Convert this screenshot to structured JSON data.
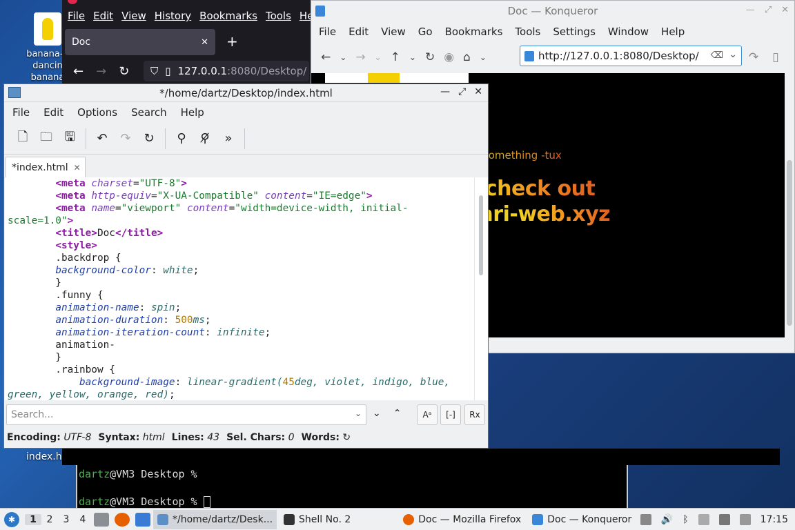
{
  "desktop": {
    "icons": [
      {
        "label": "banana-dancing-banana"
      },
      {
        "label": "index.html"
      }
    ],
    "icon_label_lines": [
      "banana-d",
      "dancin",
      "banana"
    ],
    "index_label": "index.h"
  },
  "firefox": {
    "menu": [
      "File",
      "Edit",
      "View",
      "History",
      "Bookmarks",
      "Tools",
      "Help"
    ],
    "tab_title": "Doc",
    "url_host": "127.0.0.1",
    "url_rest": ":8080/Desktop/"
  },
  "konqueror": {
    "title": "Doc — Konqueror",
    "menu": [
      "File",
      "Edit",
      "View",
      "Go",
      "Bookmarks",
      "Tools",
      "Settings",
      "Window",
      "Help"
    ],
    "url": "http://127.0.0.1:8080/Desktop/",
    "page": {
      "small_text": "el the need to desperatley install something -tux",
      "big_line1": "vim lol anyway check out",
      "big_line2": "swag website: ari-web.xyz"
    }
  },
  "editor": {
    "title": "*/home/dartz/Desktop/index.html",
    "menu": [
      "File",
      "Edit",
      "Options",
      "Search",
      "Help"
    ],
    "tab": "*index.html",
    "search_placeholder": "Search...",
    "status": {
      "encoding_label": "Encoding:",
      "encoding": "UTF-8",
      "syntax_label": "Syntax:",
      "syntax": "html",
      "lines_label": "Lines:",
      "lines": "43",
      "sel_label": "Sel. Chars:",
      "sel": "0",
      "words_label": "Words:"
    },
    "option_buttons": [
      "Aᵃ",
      "[-]",
      "Rx"
    ]
  },
  "terminal": {
    "user": "dartz",
    "prompt_rest": "@VM3 Desktop %"
  },
  "taskbar": {
    "workspaces": [
      "1",
      "2",
      "3",
      "4"
    ],
    "tasks": [
      {
        "label": "*/home/dartz/Desk..."
      },
      {
        "label": "Shell No. 2"
      },
      {
        "label": "Doc — Mozilla Firefox"
      },
      {
        "label": "Doc — Konqueror"
      }
    ],
    "clock": "17:15"
  },
  "colors": {
    "accent": "#2980b9",
    "terminal_green": "#4caf50"
  }
}
